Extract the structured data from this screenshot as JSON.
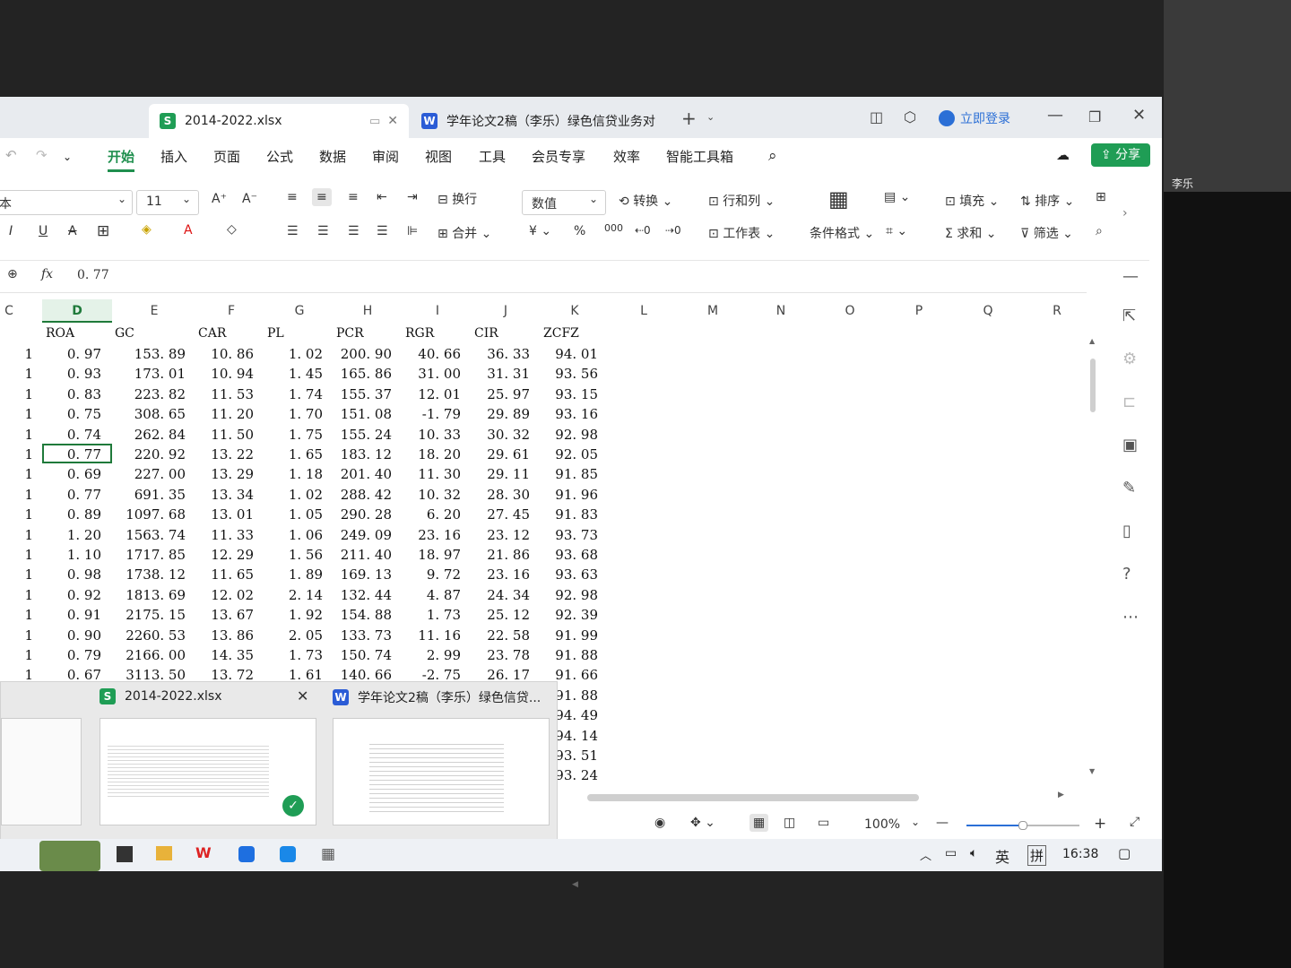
{
  "window": {
    "tabs": [
      {
        "label": "2014-2022.xlsx",
        "badge": "S"
      },
      {
        "label": "学年论文2稿（李乐）绿色信贷业务对",
        "badge": "W"
      }
    ],
    "new_tab": "+",
    "login_label": "立即登录",
    "minimize": "—",
    "restore": "❐",
    "close": "✕"
  },
  "menu": {
    "items": [
      "开始",
      "插入",
      "页面",
      "公式",
      "数据",
      "审阅",
      "视图",
      "工具",
      "会员专享",
      "效率",
      "智能工具箱"
    ],
    "active": "开始",
    "share_label": "分享"
  },
  "ribbon": {
    "font_name": "本",
    "font_size": "11",
    "wrap": "换行",
    "merge": "合并",
    "number_format": "数值",
    "convert": "转换",
    "rows_cols": "行和列",
    "worksheet": "工作表",
    "cond_format": "条件格式",
    "fill": "填充",
    "sort": "排序",
    "sum": "求和",
    "filter": "筛选",
    "percent": "%",
    "currency": "¥",
    "thousands": "000"
  },
  "formula_bar": {
    "fx": "fx",
    "value": "0. 77"
  },
  "sheet": {
    "columns": [
      "C",
      "D",
      "E",
      "F",
      "G",
      "H",
      "I",
      "J",
      "K",
      "L",
      "M",
      "N",
      "O",
      "P",
      "Q",
      "R"
    ],
    "selected_column": "D",
    "headers": [
      "ROA",
      "GC",
      "CAR",
      "PL",
      "PCR",
      "RGR",
      "CIR",
      "ZCFZ"
    ],
    "rows": [
      [
        "1",
        "0. 97",
        "153. 89",
        "10. 86",
        "1. 02",
        "200. 90",
        "40. 66",
        "36. 33",
        "94. 01"
      ],
      [
        "1",
        "0. 93",
        "173. 01",
        "10. 94",
        "1. 45",
        "165. 86",
        "31. 00",
        "31. 31",
        "93. 56"
      ],
      [
        "1",
        "0. 83",
        "223. 82",
        "11. 53",
        "1. 74",
        "155. 37",
        "12. 01",
        "25. 97",
        "93. 15"
      ],
      [
        "1",
        "0. 75",
        "308. 65",
        "11. 20",
        "1. 70",
        "151. 08",
        "-1. 79",
        "29. 89",
        "93. 16"
      ],
      [
        "1",
        "0. 74",
        "262. 84",
        "11. 50",
        "1. 75",
        "155. 24",
        "10. 33",
        "30. 32",
        "92. 98"
      ],
      [
        "1",
        "0. 77",
        "220. 92",
        "13. 22",
        "1. 65",
        "183. 12",
        "18. 20",
        "29. 61",
        "92. 05"
      ],
      [
        "1",
        "0. 69",
        "227. 00",
        "13. 29",
        "1. 18",
        "201. 40",
        "11. 30",
        "29. 11",
        "91. 85"
      ],
      [
        "1",
        "0. 77",
        "691. 35",
        "13. 34",
        "1. 02",
        "288. 42",
        "10. 32",
        "28. 30",
        "91. 96"
      ],
      [
        "1",
        "0. 89",
        "1097. 68",
        "13. 01",
        "1. 05",
        "290. 28",
        "6. 20",
        "27. 45",
        "91. 83"
      ],
      [
        "1",
        "1. 20",
        "1563. 74",
        "11. 33",
        "1. 06",
        "249. 09",
        "23. 16",
        "23. 12",
        "93. 73"
      ],
      [
        "1",
        "1. 10",
        "1717. 85",
        "12. 29",
        "1. 56",
        "211. 40",
        "18. 97",
        "21. 86",
        "93. 68"
      ],
      [
        "1",
        "0. 98",
        "1738. 12",
        "11. 65",
        "1. 89",
        "169. 13",
        "9. 72",
        "23. 16",
        "93. 63"
      ],
      [
        "1",
        "0. 92",
        "1813. 69",
        "12. 02",
        "2. 14",
        "132. 44",
        "4. 87",
        "24. 34",
        "92. 98"
      ],
      [
        "1",
        "0. 91",
        "2175. 15",
        "13. 67",
        "1. 92",
        "154. 88",
        "1. 73",
        "25. 12",
        "92. 39"
      ],
      [
        "1",
        "0. 90",
        "2260. 53",
        "13. 86",
        "2. 05",
        "133. 73",
        "11. 16",
        "22. 58",
        "91. 99"
      ],
      [
        "1",
        "0. 79",
        "2166. 00",
        "14. 35",
        "1. 73",
        "150. 74",
        "2. 99",
        "23. 78",
        "91. 88"
      ],
      [
        "1",
        "0. 67",
        "3113. 50",
        "13. 72",
        "1. 61",
        "140. 66",
        "-2. 75",
        "26. 17",
        "91. 66"
      ]
    ],
    "extra_k_values": [
      "91. 88",
      "94. 49",
      "94. 14",
      "93. 51",
      "93. 24"
    ]
  },
  "taskbar_popup": {
    "items": [
      {
        "badge": "S",
        "title": "2014-2022.xlsx"
      },
      {
        "badge": "W",
        "title": "学年论文2稿（李乐）绿色信贷..."
      }
    ],
    "close": "✕"
  },
  "statusbar": {
    "zoom": "100%",
    "minus": "—",
    "plus": "+"
  },
  "tray": {
    "ime_lang": "英",
    "ime_mode": "拼",
    "time": "16:38"
  },
  "camera": {
    "name": "李乐"
  },
  "colors": {
    "accent": "#1f9d55",
    "selected_border": "#1f7a3a",
    "link_blue": "#2b6fd6"
  }
}
